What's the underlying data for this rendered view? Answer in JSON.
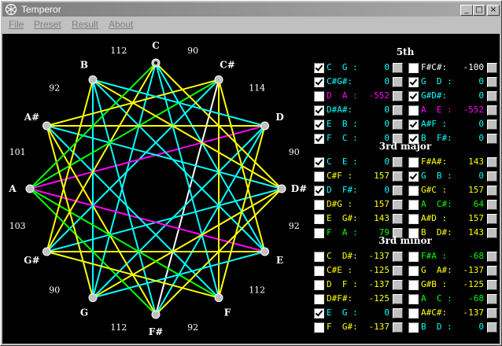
{
  "window": {
    "title": "Temperor",
    "controls": [
      "_",
      "□",
      "×"
    ]
  },
  "menu": [
    "File",
    "Preset",
    "Result",
    "About"
  ],
  "wheel": {
    "notes": [
      "C",
      "C#",
      "D",
      "D#",
      "E",
      "F",
      "F#",
      "G",
      "G#",
      "A",
      "A#",
      "B"
    ],
    "intervals": [
      "90",
      "114",
      "90",
      "92",
      "112",
      "92",
      "112",
      "90",
      "103",
      "101",
      "92",
      "112"
    ]
  },
  "sections": [
    {
      "title": "5th",
      "rows": [
        {
          "left": {
            "checked": true,
            "label": "C  G :",
            "value": "0",
            "color": "#00ffff"
          },
          "right": {
            "checked": false,
            "label": "F#C#:",
            "value": "-100",
            "color": "#ffffff"
          }
        },
        {
          "left": {
            "checked": true,
            "label": "C#G#:",
            "value": "0",
            "color": "#00ffff"
          },
          "right": {
            "checked": true,
            "label": "G  D :",
            "value": "0",
            "color": "#00ffff"
          }
        },
        {
          "left": {
            "checked": false,
            "label": "D  A :",
            "value": "-552",
            "color": "#ff00ff"
          },
          "right": {
            "checked": true,
            "label": "G#D#:",
            "value": "0",
            "color": "#00ffff"
          }
        },
        {
          "left": {
            "checked": true,
            "label": "D#A#:",
            "value": "0",
            "color": "#00ffff"
          },
          "right": {
            "checked": false,
            "label": "A  E :",
            "value": "-552",
            "color": "#ff00ff"
          }
        },
        {
          "left": {
            "checked": true,
            "label": "E  B :",
            "value": "0",
            "color": "#00ffff"
          },
          "right": {
            "checked": true,
            "label": "A#F :",
            "value": "0",
            "color": "#00ffff"
          }
        },
        {
          "left": {
            "checked": true,
            "label": "F  C :",
            "value": "0",
            "color": "#00ffff"
          },
          "right": {
            "checked": true,
            "label": "B  F#:",
            "value": "0",
            "color": "#00ffff"
          }
        }
      ]
    },
    {
      "title": "3rd major",
      "rows": [
        {
          "left": {
            "checked": true,
            "label": "C  E :",
            "value": "0",
            "color": "#00ffff"
          },
          "right": {
            "checked": false,
            "label": "F#A#:",
            "value": "143",
            "color": "#ffff00"
          }
        },
        {
          "left": {
            "checked": false,
            "label": "C#F :",
            "value": "157",
            "color": "#ffff00"
          },
          "right": {
            "checked": true,
            "label": "G  B :",
            "value": "0",
            "color": "#00ffff"
          }
        },
        {
          "left": {
            "checked": true,
            "label": "D  F#:",
            "value": "0",
            "color": "#00ffff"
          },
          "right": {
            "checked": false,
            "label": "G#C :",
            "value": "157",
            "color": "#ffff00"
          }
        },
        {
          "left": {
            "checked": false,
            "label": "D#G :",
            "value": "157",
            "color": "#ffff00"
          },
          "right": {
            "checked": false,
            "label": "A  C#:",
            "value": "64",
            "color": "#00ff00"
          }
        },
        {
          "left": {
            "checked": false,
            "label": "E  G#:",
            "value": "143",
            "color": "#ffff00"
          },
          "right": {
            "checked": false,
            "label": "A#D :",
            "value": "157",
            "color": "#ffff00"
          }
        },
        {
          "left": {
            "checked": false,
            "label": "F  A :",
            "value": "79",
            "color": "#00ff00"
          },
          "right": {
            "checked": false,
            "label": "B  D#:",
            "value": "143",
            "color": "#ffff00"
          }
        }
      ]
    },
    {
      "title": "3rd minor",
      "rows": [
        {
          "left": {
            "checked": false,
            "label": "C  D#:",
            "value": "-137",
            "color": "#ffff00"
          },
          "right": {
            "checked": false,
            "label": "F#A :",
            "value": "-68",
            "color": "#00ff00"
          }
        },
        {
          "left": {
            "checked": false,
            "label": "C#E :",
            "value": "-125",
            "color": "#ffff00"
          },
          "right": {
            "checked": false,
            "label": "G  A#:",
            "value": "-137",
            "color": "#ffff00"
          }
        },
        {
          "left": {
            "checked": false,
            "label": "D  F :",
            "value": "-137",
            "color": "#ffff00"
          },
          "right": {
            "checked": false,
            "label": "G#B :",
            "value": "-125",
            "color": "#ffff00"
          }
        },
        {
          "left": {
            "checked": false,
            "label": "D#F#:",
            "value": "-125",
            "color": "#ffff00"
          },
          "right": {
            "checked": false,
            "label": "A  C :",
            "value": "-68",
            "color": "#00ff00"
          }
        },
        {
          "left": {
            "checked": true,
            "label": "E  G :",
            "value": "0",
            "color": "#00ffff"
          },
          "right": {
            "checked": false,
            "label": "A#C#:",
            "value": "-137",
            "color": "#ffff00"
          }
        },
        {
          "left": {
            "checked": false,
            "label": "F  G#:",
            "value": "-137",
            "color": "#ffff00"
          },
          "right": {
            "checked": false,
            "label": "B  D :",
            "value": "0",
            "color": "#00ffff"
          }
        }
      ]
    }
  ]
}
